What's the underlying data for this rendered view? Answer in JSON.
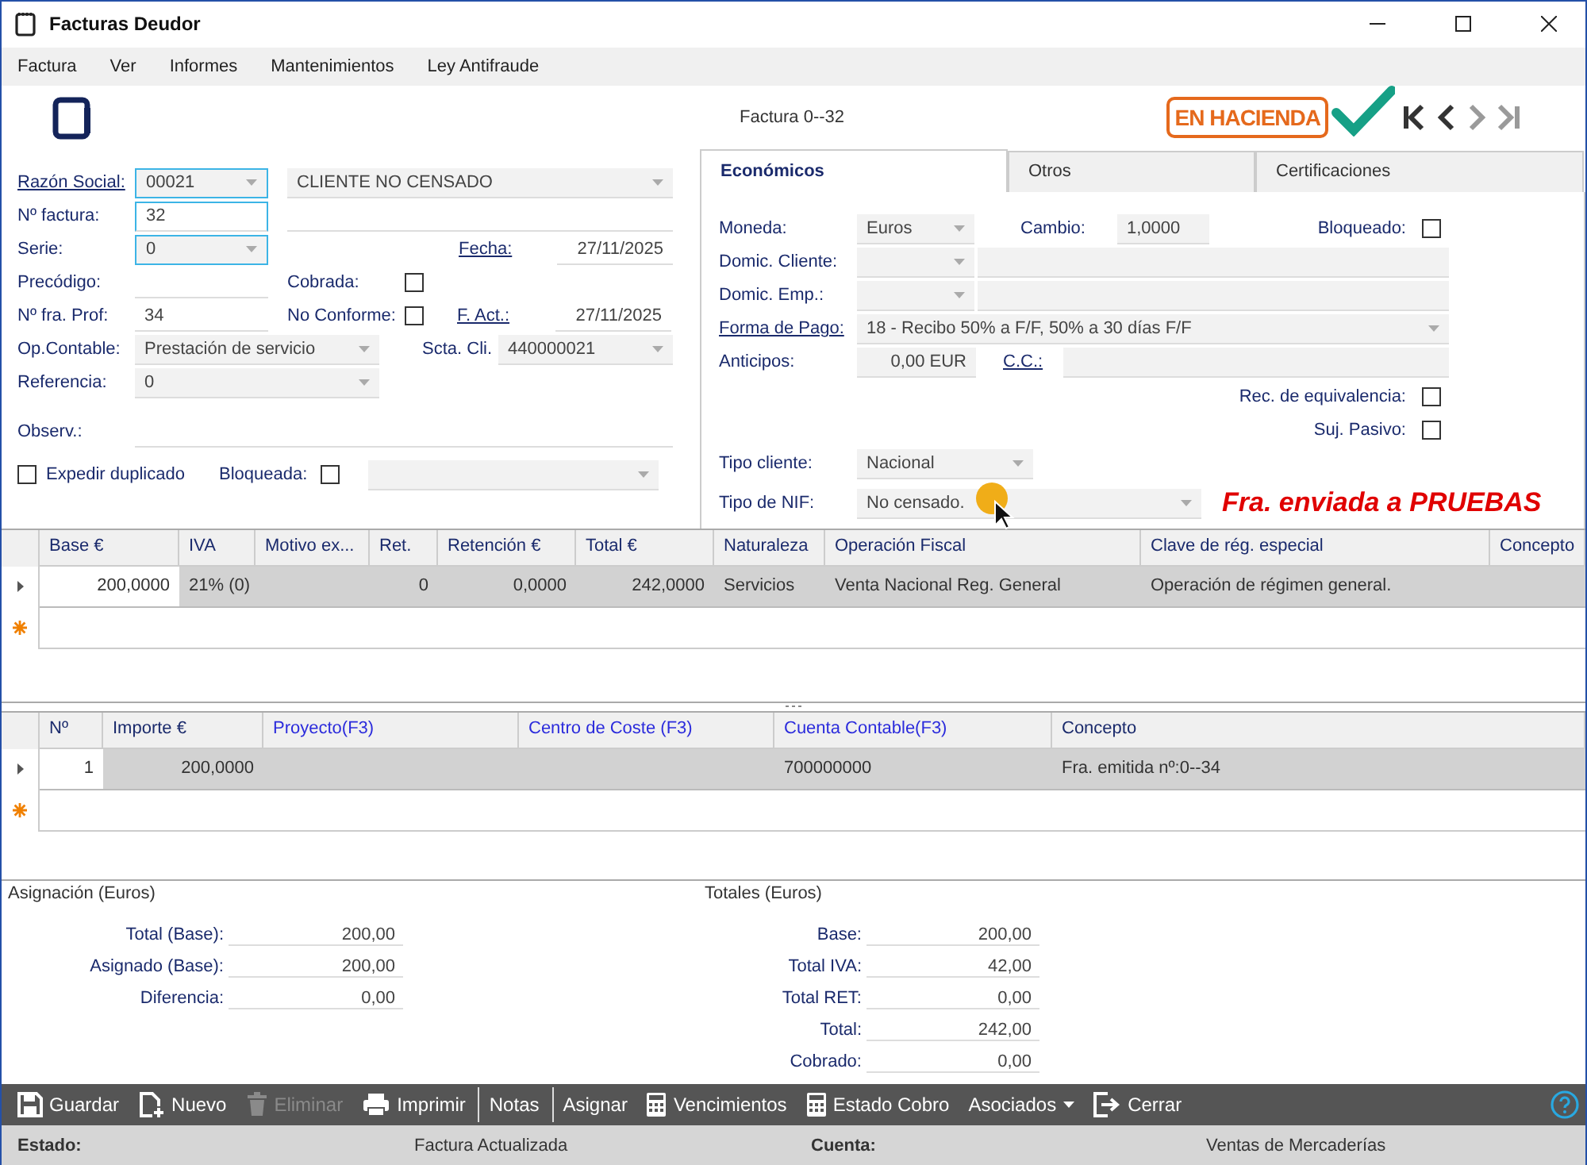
{
  "window": {
    "title": "Facturas Deudor"
  },
  "menu": [
    "Factura",
    "Ver",
    "Informes",
    "Mantenimientos",
    "Ley Antifraude"
  ],
  "header": {
    "invoice": "Factura 0--32",
    "badge": "EN HACIENDA",
    "verified": true
  },
  "nav_buttons": [
    {
      "kind": "first",
      "disabled": false
    },
    {
      "kind": "previous",
      "disabled": false
    },
    {
      "kind": "next",
      "disabled": true
    },
    {
      "kind": "last",
      "disabled": true
    }
  ],
  "form": {
    "razon_social": {
      "label": "Razón Social:",
      "code": "00021",
      "name": "CLIENTE NO CENSADO"
    },
    "numero_factura": {
      "label": "Nº factura:",
      "value": "32"
    },
    "serie": {
      "label": "Serie:",
      "value": "0"
    },
    "fecha": {
      "label": "Fecha:",
      "value": "27/11/2025"
    },
    "precodigo": {
      "label": "Precódigo:"
    },
    "cobrada": {
      "label": "Cobrada:",
      "checked": false
    },
    "num_fra_prof": {
      "label": "Nº fra. Prof:",
      "value": "34"
    },
    "no_conforme": {
      "label": "No Conforme:",
      "checked": false
    },
    "f_act": {
      "label": "F. Act.:",
      "value": "27/11/2025"
    },
    "op_contable": {
      "label": "Op.Contable:",
      "value": "Prestación de servicio"
    },
    "scta_cli": {
      "label": "Scta. Cli.",
      "value": "440000021"
    },
    "referencia": {
      "label": "Referencia:",
      "value": "0"
    },
    "observ": {
      "label": "Observ.:"
    },
    "expedir_duplicado": {
      "label": "Expedir duplicado",
      "checked": false
    },
    "bloqueada": {
      "label": "Bloqueada:",
      "checked": false
    }
  },
  "tabs": [
    {
      "label": "Económicos",
      "selected": true
    },
    {
      "label": "Otros",
      "selected": false
    },
    {
      "label": "Certificaciones",
      "selected": false
    }
  ],
  "economicos": {
    "moneda": {
      "label": "Moneda:",
      "value": "Euros"
    },
    "cambio": {
      "label": "Cambio:",
      "value": "1,0000"
    },
    "bloqueado": {
      "label": "Bloqueado:",
      "checked": false
    },
    "domic_cliente": {
      "label": "Domic. Cliente:"
    },
    "domic_emp": {
      "label": "Domic. Emp.:"
    },
    "forma_pago": {
      "label": "Forma de Pago:",
      "value": "18 - Recibo 50% a F/F, 50% a 30 días F/F"
    },
    "anticipos": {
      "label": "Anticipos:",
      "value": "0,00 EUR"
    },
    "cc": {
      "label": "C.C.:"
    },
    "rec_equivalencia": {
      "label": "Rec. de equivalencia:",
      "checked": false
    },
    "suj_pasivo": {
      "label": "Suj. Pasivo:",
      "checked": false
    },
    "tipo_cliente": {
      "label": "Tipo cliente:",
      "value": "Nacional"
    },
    "tipo_nif": {
      "label": "Tipo de NIF:",
      "value": "No censado."
    },
    "notice": "Fra. enviada a PRUEBAS"
  },
  "lines_table": {
    "columns": [
      {
        "label": "Base €",
        "lookup": false
      },
      {
        "label": "IVA",
        "lookup": false
      },
      {
        "label": "Motivo ex...",
        "lookup": false
      },
      {
        "label": "Ret.",
        "lookup": false
      },
      {
        "label": "Retención €",
        "lookup": false
      },
      {
        "label": "Total €",
        "lookup": false
      },
      {
        "label": "Naturaleza",
        "lookup": false
      },
      {
        "label": "Operación Fiscal",
        "lookup": false
      },
      {
        "label": "Clave de rég. especial",
        "lookup": false
      },
      {
        "label": "Concepto",
        "lookup": false
      }
    ],
    "rows": [
      [
        "200,0000",
        "21% (0)",
        "",
        "0",
        "0,0000",
        "242,0000",
        "Servicios",
        "Venta Nacional Reg. General",
        "Operación de régimen general.",
        ""
      ]
    ]
  },
  "allocation_table": {
    "columns": [
      {
        "label": "Nº",
        "lookup": false
      },
      {
        "label": "Importe €",
        "lookup": false
      },
      {
        "label": "Proyecto(F3)",
        "lookup": true
      },
      {
        "label": "Centro de Coste (F3)",
        "lookup": true
      },
      {
        "label": "Cuenta Contable(F3)",
        "lookup": true
      },
      {
        "label": "Concepto",
        "lookup": false
      }
    ],
    "rows": [
      [
        "1",
        "200,0000",
        "",
        "",
        "700000000",
        "Fra. emitida nº:0--34"
      ]
    ]
  },
  "asignacion": {
    "title": "Asignación (Euros)",
    "rows": [
      {
        "label": "Total (Base):",
        "value": "200,00"
      },
      {
        "label": "Asignado (Base):",
        "value": "200,00"
      },
      {
        "label": "Diferencia:",
        "value": "0,00"
      }
    ]
  },
  "totales": {
    "title": "Totales (Euros)",
    "rows": [
      {
        "label": "Base:",
        "value": "200,00"
      },
      {
        "label": "Total IVA:",
        "value": "42,00"
      },
      {
        "label": "Total RET:",
        "value": "0,00"
      },
      {
        "label": "Total:",
        "value": "242,00"
      },
      {
        "label": "Cobrado:",
        "value": "0,00"
      }
    ]
  },
  "toolbar": [
    {
      "label": "Guardar",
      "kind": "save",
      "disabled": false,
      "separator_before": false
    },
    {
      "label": "Nuevo",
      "kind": "new",
      "disabled": false,
      "separator_before": false
    },
    {
      "label": "Eliminar",
      "kind": "delete",
      "disabled": true,
      "separator_before": false
    },
    {
      "label": "Imprimir",
      "kind": "print",
      "disabled": false,
      "separator_before": false
    },
    {
      "label": "Notas",
      "kind": "text",
      "disabled": false,
      "separator_before": true
    },
    {
      "label": "Asignar",
      "kind": "text",
      "disabled": false,
      "separator_before": true
    },
    {
      "label": "Vencimientos",
      "kind": "calculator",
      "disabled": false,
      "separator_before": false
    },
    {
      "label": "Estado Cobro",
      "kind": "calculator",
      "disabled": false,
      "separator_before": false
    },
    {
      "label": "Asociados",
      "kind": "dropdown",
      "disabled": false,
      "separator_before": false
    },
    {
      "label": "Cerrar",
      "kind": "exit",
      "disabled": false,
      "separator_before": false
    }
  ],
  "status_bar": [
    {
      "kind": "label",
      "text": "Estado:"
    },
    {
      "kind": "value",
      "text": "Factura Actualizada"
    },
    {
      "kind": "label",
      "text": "Cuenta:"
    },
    {
      "kind": "value",
      "text": "Ventas de Mercaderías"
    }
  ]
}
